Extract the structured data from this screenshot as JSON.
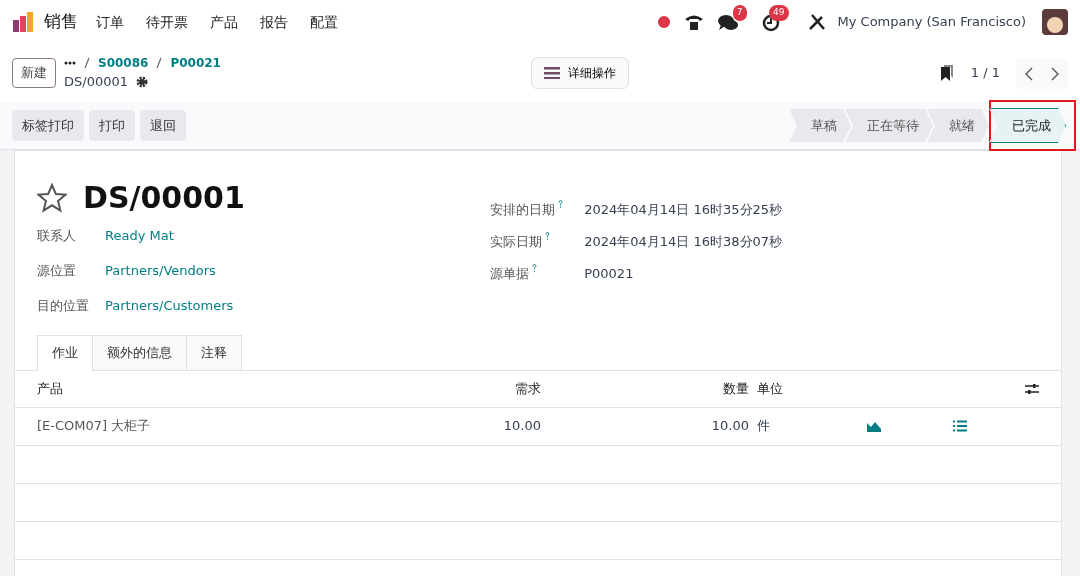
{
  "navbar": {
    "app": "销售",
    "menus": [
      "订单",
      "待开票",
      "产品",
      "报告",
      "配置"
    ],
    "messages_count": "7",
    "activities_count": "49",
    "company": "My Company (San Francisco)"
  },
  "control_panel": {
    "new_button": "新建",
    "breadcrumbs": [
      "S00086",
      "P00021"
    ],
    "record": "DS/00001",
    "actions_button": "详细操作",
    "pager": "1 / 1"
  },
  "action_buttons": [
    "标签打印",
    "打印",
    "退回"
  ],
  "stages": [
    {
      "label": "草稿",
      "selected": false,
      "highlighted": false
    },
    {
      "label": "正在等待",
      "selected": false,
      "highlighted": false
    },
    {
      "label": "就绪",
      "selected": false,
      "highlighted": false
    },
    {
      "label": "已完成",
      "selected": true,
      "highlighted": true
    }
  ],
  "title": "DS/00001",
  "left_fields": [
    {
      "label": "联系人",
      "value": "Ready Mat"
    },
    {
      "label": "源位置",
      "value": "Partners/Vendors"
    },
    {
      "label": "目的位置",
      "value": "Partners/Customers"
    }
  ],
  "right_fields": [
    {
      "label": "安排的日期",
      "value": "2024年04月14日 16时35分25秒"
    },
    {
      "label": "实际日期",
      "value": "2024年04月14日 16时38分07秒"
    },
    {
      "label": "源单据",
      "value": "P00021"
    }
  ],
  "tabs": [
    {
      "label": "作业",
      "selected": true
    },
    {
      "label": "额外的信息",
      "selected": false
    },
    {
      "label": "注释",
      "selected": false
    }
  ],
  "table": {
    "columns": [
      "产品",
      "需求",
      "数量",
      "单位"
    ],
    "rows": [
      {
        "product": "[E-COM07] 大柜子",
        "demand": "10.00",
        "quantity": "10.00",
        "unit": "件"
      }
    ]
  }
}
